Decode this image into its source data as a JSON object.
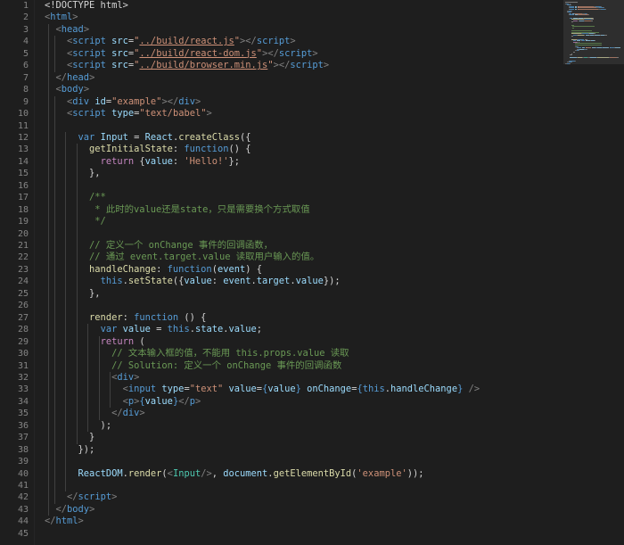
{
  "editor": {
    "language": "HTML",
    "colors": {
      "background": "#1e1e1e",
      "line_number": "#858585",
      "tag": "#569cd6",
      "attribute": "#9cdcfe",
      "string": "#ce9178",
      "keyword": "#569cd6",
      "control": "#c586c0",
      "function": "#dcdcaa",
      "class": "#4ec9b0",
      "comment": "#6a9955"
    },
    "line_numbers": [
      "1",
      "2",
      "3",
      "4",
      "5",
      "6",
      "7",
      "8",
      "9",
      "10",
      "11",
      "12",
      "13",
      "14",
      "15",
      "16",
      "17",
      "18",
      "19",
      "20",
      "21",
      "22",
      "23",
      "24",
      "25",
      "26",
      "27",
      "28",
      "29",
      "30",
      "31",
      "32",
      "33",
      "34",
      "35",
      "36",
      "37",
      "38",
      "39",
      "40",
      "41",
      "42",
      "43",
      "44",
      "45"
    ],
    "lines": [
      [
        [
          "t-plain",
          "<!DOCTYPE html>"
        ]
      ],
      [
        [
          "t-bracket",
          "<"
        ],
        [
          "t-tag",
          "html"
        ],
        [
          "t-bracket",
          ">"
        ]
      ],
      [
        [
          "t-plain",
          "  "
        ],
        [
          "t-bracket",
          "<"
        ],
        [
          "t-tag",
          "head"
        ],
        [
          "t-bracket",
          ">"
        ]
      ],
      [
        [
          "t-plain",
          "    "
        ],
        [
          "t-bracket",
          "<"
        ],
        [
          "t-tag",
          "script"
        ],
        [
          "t-plain",
          " "
        ],
        [
          "t-attr",
          "src"
        ],
        [
          "t-plain",
          "="
        ],
        [
          "t-str",
          "\""
        ],
        [
          "t-link",
          "../build/react.js"
        ],
        [
          "t-str",
          "\""
        ],
        [
          "t-bracket",
          "></"
        ],
        [
          "t-tag",
          "script"
        ],
        [
          "t-bracket",
          ">"
        ]
      ],
      [
        [
          "t-plain",
          "    "
        ],
        [
          "t-bracket",
          "<"
        ],
        [
          "t-tag",
          "script"
        ],
        [
          "t-plain",
          " "
        ],
        [
          "t-attr",
          "src"
        ],
        [
          "t-plain",
          "="
        ],
        [
          "t-str",
          "\""
        ],
        [
          "t-link",
          "../build/react-dom.js"
        ],
        [
          "t-str",
          "\""
        ],
        [
          "t-bracket",
          "></"
        ],
        [
          "t-tag",
          "script"
        ],
        [
          "t-bracket",
          ">"
        ]
      ],
      [
        [
          "t-plain",
          "    "
        ],
        [
          "t-bracket",
          "<"
        ],
        [
          "t-tag",
          "script"
        ],
        [
          "t-plain",
          " "
        ],
        [
          "t-attr",
          "src"
        ],
        [
          "t-plain",
          "="
        ],
        [
          "t-str",
          "\""
        ],
        [
          "t-link",
          "../build/browser.min.js"
        ],
        [
          "t-str",
          "\""
        ],
        [
          "t-bracket",
          "></"
        ],
        [
          "t-tag",
          "script"
        ],
        [
          "t-bracket",
          ">"
        ]
      ],
      [
        [
          "t-plain",
          "  "
        ],
        [
          "t-bracket",
          "</"
        ],
        [
          "t-tag",
          "head"
        ],
        [
          "t-bracket",
          ">"
        ]
      ],
      [
        [
          "t-plain",
          "  "
        ],
        [
          "t-bracket",
          "<"
        ],
        [
          "t-tag",
          "body"
        ],
        [
          "t-bracket",
          ">"
        ]
      ],
      [
        [
          "t-plain",
          "    "
        ],
        [
          "t-bracket",
          "<"
        ],
        [
          "t-tag",
          "div"
        ],
        [
          "t-plain",
          " "
        ],
        [
          "t-attr",
          "id"
        ],
        [
          "t-plain",
          "="
        ],
        [
          "t-str",
          "\"example\""
        ],
        [
          "t-bracket",
          "></"
        ],
        [
          "t-tag",
          "div"
        ],
        [
          "t-bracket",
          ">"
        ]
      ],
      [
        [
          "t-plain",
          "    "
        ],
        [
          "t-bracket",
          "<"
        ],
        [
          "t-tag",
          "script"
        ],
        [
          "t-plain",
          " "
        ],
        [
          "t-attr",
          "type"
        ],
        [
          "t-plain",
          "="
        ],
        [
          "t-str",
          "\"text/babel\""
        ],
        [
          "t-bracket",
          ">"
        ]
      ],
      [],
      [
        [
          "t-plain",
          "      "
        ],
        [
          "t-kw",
          "var"
        ],
        [
          "t-plain",
          " "
        ],
        [
          "t-var",
          "Input"
        ],
        [
          "t-plain",
          " = "
        ],
        [
          "t-var",
          "React"
        ],
        [
          "t-plain",
          "."
        ],
        [
          "t-fn",
          "createClass"
        ],
        [
          "t-plain",
          "({"
        ]
      ],
      [
        [
          "t-plain",
          "        "
        ],
        [
          "t-fn",
          "getInitialState"
        ],
        [
          "t-plain",
          ": "
        ],
        [
          "t-kw",
          "function"
        ],
        [
          "t-plain",
          "() {"
        ]
      ],
      [
        [
          "t-plain",
          "          "
        ],
        [
          "t-ctrl",
          "return"
        ],
        [
          "t-plain",
          " {"
        ],
        [
          "t-var",
          "value"
        ],
        [
          "t-plain",
          ": "
        ],
        [
          "t-str",
          "'Hello!'"
        ],
        [
          "t-plain",
          "};"
        ]
      ],
      [
        [
          "t-plain",
          "        },"
        ]
      ],
      [],
      [
        [
          "t-plain",
          "        "
        ],
        [
          "t-cm",
          "/**"
        ]
      ],
      [
        [
          "t-plain",
          "        "
        ],
        [
          "t-cm",
          " * 此时的value还是state，只是需要换个方式取值"
        ]
      ],
      [
        [
          "t-plain",
          "        "
        ],
        [
          "t-cm",
          " */"
        ]
      ],
      [],
      [
        [
          "t-plain",
          "        "
        ],
        [
          "t-cm",
          "// 定义一个 onChange 事件的回调函数，"
        ]
      ],
      [
        [
          "t-plain",
          "        "
        ],
        [
          "t-cm",
          "// 通过 event.target.value 读取用户输入的值。"
        ]
      ],
      [
        [
          "t-plain",
          "        "
        ],
        [
          "t-fn",
          "handleChange"
        ],
        [
          "t-plain",
          ": "
        ],
        [
          "t-kw",
          "function"
        ],
        [
          "t-plain",
          "("
        ],
        [
          "t-var",
          "event"
        ],
        [
          "t-plain",
          ") {"
        ]
      ],
      [
        [
          "t-plain",
          "          "
        ],
        [
          "t-kw",
          "this"
        ],
        [
          "t-plain",
          "."
        ],
        [
          "t-fn",
          "setState"
        ],
        [
          "t-plain",
          "({"
        ],
        [
          "t-var",
          "value"
        ],
        [
          "t-plain",
          ": "
        ],
        [
          "t-var",
          "event"
        ],
        [
          "t-plain",
          "."
        ],
        [
          "t-var",
          "target"
        ],
        [
          "t-plain",
          "."
        ],
        [
          "t-var",
          "value"
        ],
        [
          "t-plain",
          "});"
        ]
      ],
      [
        [
          "t-plain",
          "        },"
        ]
      ],
      [],
      [
        [
          "t-plain",
          "        "
        ],
        [
          "t-fn",
          "render"
        ],
        [
          "t-plain",
          ": "
        ],
        [
          "t-kw",
          "function"
        ],
        [
          "t-plain",
          " () {"
        ]
      ],
      [
        [
          "t-plain",
          "          "
        ],
        [
          "t-kw",
          "var"
        ],
        [
          "t-plain",
          " "
        ],
        [
          "t-var",
          "value"
        ],
        [
          "t-plain",
          " = "
        ],
        [
          "t-kw",
          "this"
        ],
        [
          "t-plain",
          "."
        ],
        [
          "t-var",
          "state"
        ],
        [
          "t-plain",
          "."
        ],
        [
          "t-var",
          "value"
        ],
        [
          "t-plain",
          ";"
        ]
      ],
      [
        [
          "t-plain",
          "          "
        ],
        [
          "t-ctrl",
          "return"
        ],
        [
          "t-plain",
          " ("
        ]
      ],
      [
        [
          "t-plain",
          "            "
        ],
        [
          "t-cm",
          "// 文本输入框的值，不能用 this.props.value 读取"
        ]
      ],
      [
        [
          "t-plain",
          "            "
        ],
        [
          "t-cm",
          "// Solution: 定义一个 onChange 事件的回调函数"
        ]
      ],
      [
        [
          "t-plain",
          "            "
        ],
        [
          "t-bracket",
          "<"
        ],
        [
          "t-tag",
          "div"
        ],
        [
          "t-bracket",
          ">"
        ]
      ],
      [
        [
          "t-plain",
          "              "
        ],
        [
          "t-bracket",
          "<"
        ],
        [
          "t-tag",
          "input"
        ],
        [
          "t-plain",
          " "
        ],
        [
          "t-attr",
          "type"
        ],
        [
          "t-plain",
          "="
        ],
        [
          "t-str",
          "\"text\""
        ],
        [
          "t-plain",
          " "
        ],
        [
          "t-attr",
          "value"
        ],
        [
          "t-plain",
          "="
        ],
        [
          "t-kw",
          "{"
        ],
        [
          "t-var",
          "value"
        ],
        [
          "t-kw",
          "}"
        ],
        [
          "t-plain",
          " "
        ],
        [
          "t-attr",
          "onChange"
        ],
        [
          "t-plain",
          "="
        ],
        [
          "t-kw",
          "{this"
        ],
        [
          "t-plain",
          "."
        ],
        [
          "t-var",
          "handleChange"
        ],
        [
          "t-kw",
          "}"
        ],
        [
          "t-plain",
          " "
        ],
        [
          "t-bracket",
          "/>"
        ]
      ],
      [
        [
          "t-plain",
          "              "
        ],
        [
          "t-bracket",
          "<"
        ],
        [
          "t-tag",
          "p"
        ],
        [
          "t-bracket",
          ">"
        ],
        [
          "t-kw",
          "{"
        ],
        [
          "t-var",
          "value"
        ],
        [
          "t-kw",
          "}"
        ],
        [
          "t-bracket",
          "</"
        ],
        [
          "t-tag",
          "p"
        ],
        [
          "t-bracket",
          ">"
        ]
      ],
      [
        [
          "t-plain",
          "            "
        ],
        [
          "t-bracket",
          "</"
        ],
        [
          "t-tag",
          "div"
        ],
        [
          "t-bracket",
          ">"
        ]
      ],
      [
        [
          "t-plain",
          "          );"
        ]
      ],
      [
        [
          "t-plain",
          "        }"
        ]
      ],
      [
        [
          "t-plain",
          "      });"
        ]
      ],
      [],
      [
        [
          "t-plain",
          "      "
        ],
        [
          "t-var",
          "ReactDOM"
        ],
        [
          "t-plain",
          "."
        ],
        [
          "t-fn",
          "render"
        ],
        [
          "t-plain",
          "("
        ],
        [
          "t-bracket",
          "<"
        ],
        [
          "t-cls",
          "Input"
        ],
        [
          "t-bracket",
          "/>"
        ],
        [
          "t-plain",
          ", "
        ],
        [
          "t-var",
          "document"
        ],
        [
          "t-plain",
          "."
        ],
        [
          "t-fn",
          "getElementById"
        ],
        [
          "t-plain",
          "("
        ],
        [
          "t-str",
          "'example'"
        ],
        [
          "t-plain",
          "));"
        ]
      ],
      [],
      [
        [
          "t-plain",
          "    "
        ],
        [
          "t-bracket",
          "</"
        ],
        [
          "t-tag",
          "script"
        ],
        [
          "t-bracket",
          ">"
        ]
      ],
      [
        [
          "t-plain",
          "  "
        ],
        [
          "t-bracket",
          "</"
        ],
        [
          "t-tag",
          "body"
        ],
        [
          "t-bracket",
          ">"
        ]
      ],
      [
        [
          "t-bracket",
          "</"
        ],
        [
          "t-tag",
          "html"
        ],
        [
          "t-bracket",
          ">"
        ]
      ],
      []
    ]
  }
}
